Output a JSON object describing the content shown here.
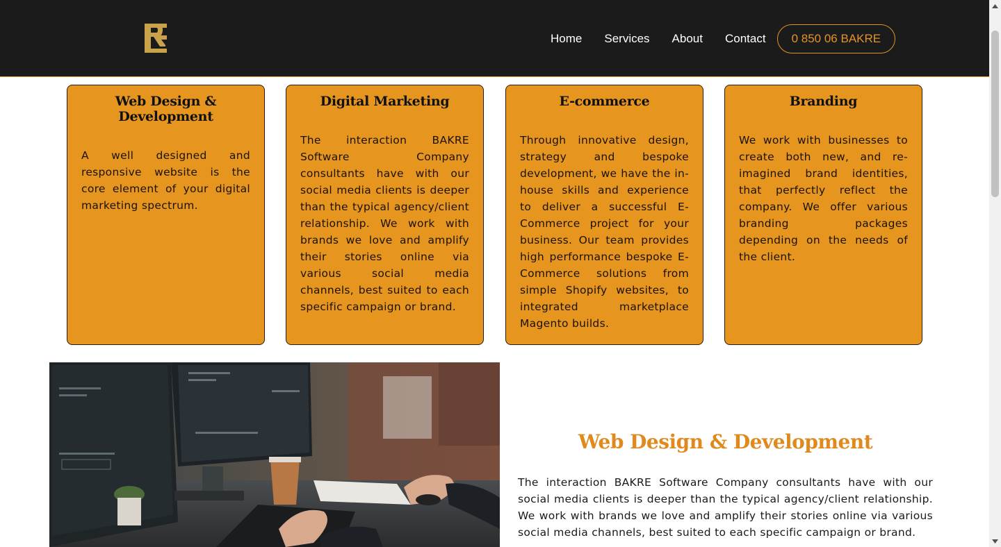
{
  "nav": {
    "links": [
      "Home",
      "Services",
      "About",
      "Contact"
    ],
    "phone": "0 850 06 BAKRE",
    "colors": {
      "background": "#1b1b1b",
      "accent": "#e49326"
    }
  },
  "services": [
    {
      "title": "Web Design & Development",
      "text": "A well designed and responsive website is the core element of your digital marketing spectrum."
    },
    {
      "title": "Digital Marketing",
      "text": "The interaction BAKRE Software Company consultants have with our social media clients is deeper than the typical agency/client relationship. We work with brands we love and amplify their stories online via various social media channels, best suited to each specific campaign or brand."
    },
    {
      "title": "E-commerce",
      "text": "Through innovative design, strategy and bespoke development, we have the in-house skills and experience to deliver a successful E-Commerce project for your business. Our team provides high performance bespoke E-Commerce solutions from simple Shopify websites, to integrated marketplace Magento builds."
    },
    {
      "title": "Branding",
      "text": "We work with businesses to create both new, and re-imagined brand identities, that perfectly reflect the company. We offer various branding packages depending on the needs of the client."
    }
  ],
  "feature": {
    "title": "Web Design & Development",
    "text": "The interaction BAKRE Software Company consultants have with our social media clients is deeper than the typical agency/client relationship. We work with brands we love and amplify their stories online via various social media channels, best suited to each specific campaign or brand."
  },
  "colors": {
    "card": "#e6951f",
    "feature_title": "#e08a1e"
  }
}
